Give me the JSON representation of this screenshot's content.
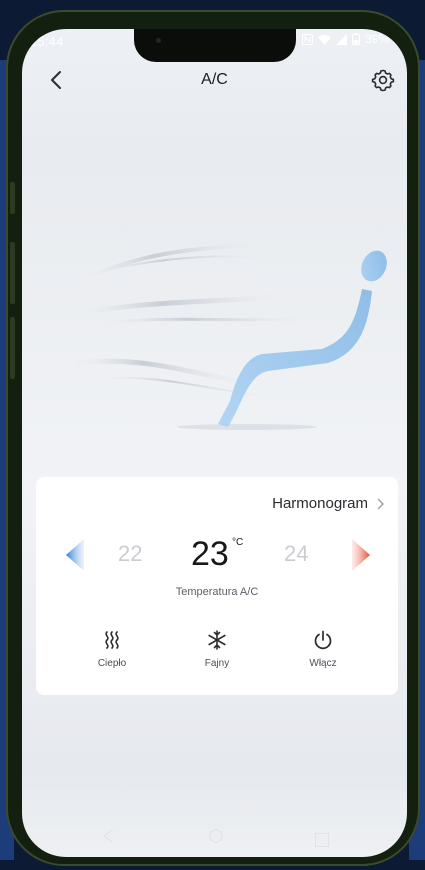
{
  "status_bar": {
    "time": "15:44",
    "battery": "39%"
  },
  "header": {
    "title": "A/C"
  },
  "card": {
    "schedule_label": "Harmonogram",
    "temp_prev": "22",
    "temp_current": "23",
    "temp_unit": "°C",
    "temp_next": "24",
    "temp_caption": "Temperatura A/C",
    "modes": [
      {
        "label": "Ciepło",
        "icon": "heat-waves-icon"
      },
      {
        "label": "Fajny",
        "icon": "snowflake-icon"
      },
      {
        "label": "Włącz",
        "icon": "power-icon"
      }
    ]
  },
  "colors": {
    "accent_cool": "#3a8de0",
    "accent_warm": "#e8553a",
    "seat_blue": "#8fc0ea"
  }
}
